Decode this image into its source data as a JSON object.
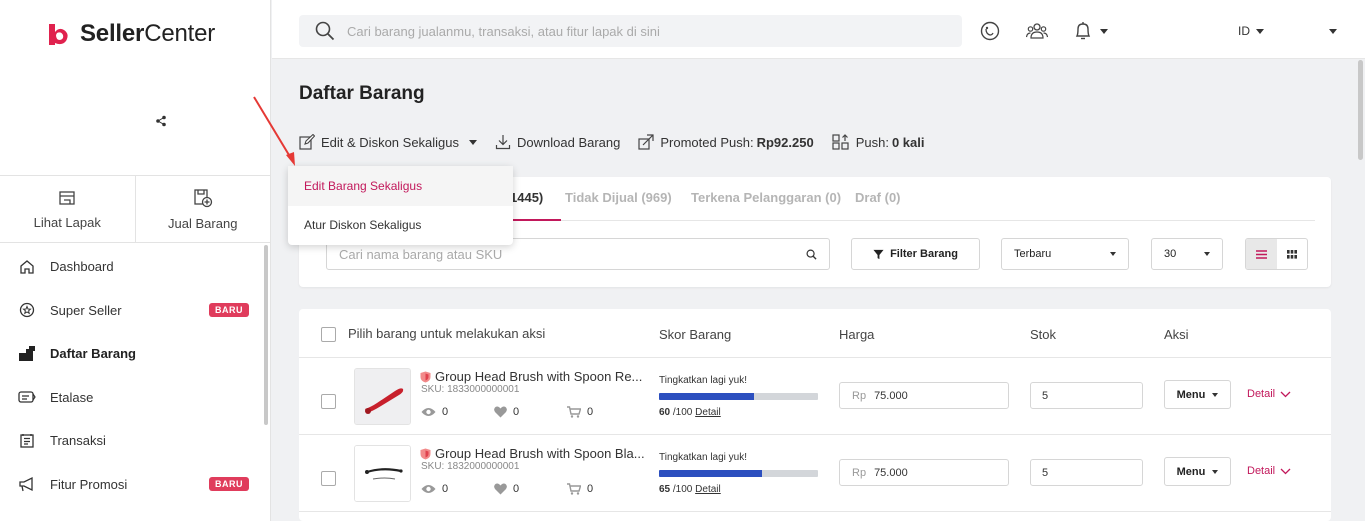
{
  "brand": {
    "name_bold": "Seller",
    "name_rest": "Center",
    "color": "#e0224e"
  },
  "sidebar": {
    "quick_actions": [
      {
        "label": "Lihat Lapak",
        "icon": "store-icon"
      },
      {
        "label": "Jual Barang",
        "icon": "add-product-icon"
      }
    ],
    "items": [
      {
        "label": "Dashboard",
        "icon": "home-icon"
      },
      {
        "label": "Super Seller",
        "icon": "medal-icon",
        "badge": "BARU"
      },
      {
        "label": "Daftar Barang",
        "icon": "boxes-icon",
        "active": true
      },
      {
        "label": "Etalase",
        "icon": "tag-icon"
      },
      {
        "label": "Transaksi",
        "icon": "receipt-icon"
      },
      {
        "label": "Fitur Promosi",
        "icon": "megaphone-icon",
        "badge": "BARU"
      }
    ]
  },
  "topbar": {
    "search_placeholder": "Cari barang jualanmu, transaksi, atau fitur lapak di sini",
    "language": "ID"
  },
  "page": {
    "title": "Daftar Barang",
    "actions": {
      "bulk_edit": "Edit & Diskon Sekaligus",
      "download": "Download Barang",
      "promoted_push_label": "Promoted Push:",
      "promoted_push_value": "Rp92.250",
      "push_label": "Push:",
      "push_value": "0 kali"
    },
    "dropdown": [
      "Edit Barang Sekaligus",
      "Atur Diskon Sekaligus"
    ],
    "tabs": [
      {
        "label": "1445)",
        "active": true
      },
      {
        "label": "Tidak Dijual (969)"
      },
      {
        "label": "Terkena Pelanggaran (0)"
      },
      {
        "label": "Draf (0)"
      }
    ],
    "product_search_placeholder": "Cari nama barang atau SKU",
    "filter_label": "Filter Barang",
    "sort_value": "Terbaru",
    "per_page_value": "30"
  },
  "table": {
    "headers": {
      "select": "Pilih barang untuk melakukan aksi",
      "score": "Skor Barang",
      "price": "Harga",
      "stock": "Stok",
      "action": "Aksi"
    },
    "rows": [
      {
        "name": "Group Head Brush with Spoon Re...",
        "sku": "SKU: 1833000000001",
        "views": "0",
        "likes": "0",
        "sold": "0",
        "score_hint": "Tingkatkan lagi yuk!",
        "score": 60,
        "score_max": "/100",
        "score_link": "Detail",
        "price_prefix": "Rp",
        "price": "75.000",
        "stock": "5",
        "menu_label": "Menu",
        "detail_label": "Detail"
      },
      {
        "name": "Group Head Brush with Spoon Bla...",
        "sku": "SKU: 1832000000001",
        "views": "0",
        "likes": "0",
        "sold": "0",
        "score_hint": "Tingkatkan lagi yuk!",
        "score": 65,
        "score_max": "/100",
        "score_link": "Detail",
        "price_prefix": "Rp",
        "price": "75.000",
        "stock": "5",
        "menu_label": "Menu",
        "detail_label": "Detail"
      }
    ]
  },
  "colors": {
    "accent": "#c2185b",
    "score_bar": "#2c4fbf",
    "badge": "#e03c5c"
  }
}
